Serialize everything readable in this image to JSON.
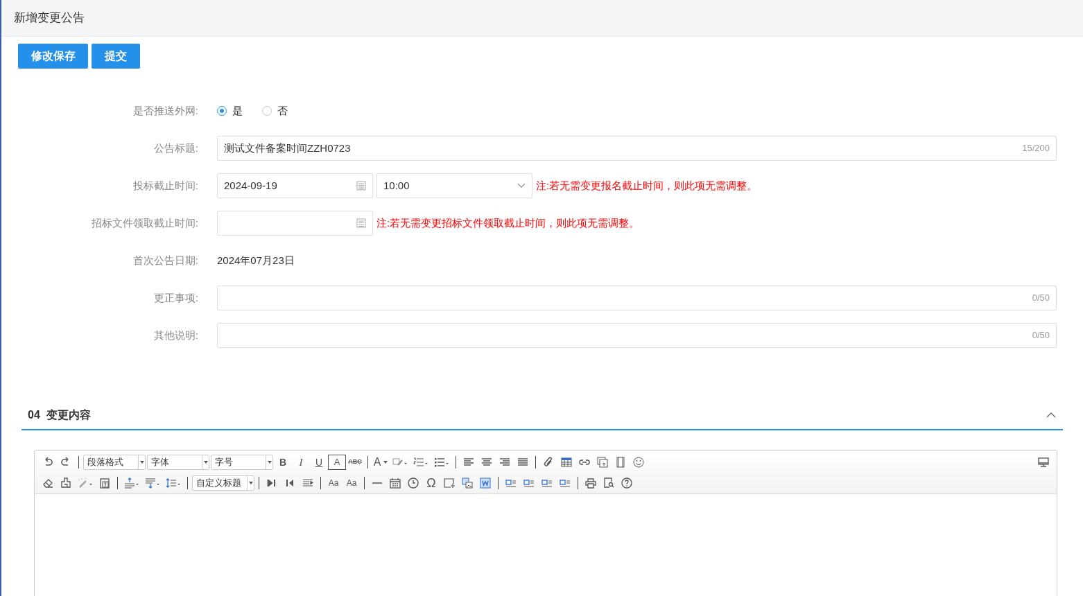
{
  "page_title": "新增变更公告",
  "actions": [
    {
      "label": "修改保存"
    },
    {
      "label": "提交"
    }
  ],
  "form": {
    "push": {
      "label": "是否推送外网:",
      "options": [
        {
          "label": "是",
          "selected": true
        },
        {
          "label": "否",
          "selected": false
        }
      ]
    },
    "title": {
      "label": "公告标题:",
      "value": "测试文件备案时间ZZH0723",
      "count": "15/200"
    },
    "bid_deadline": {
      "label": "投标截止时间:",
      "date": "2024-09-19",
      "time": "10:00",
      "note": "注:若无需变更报名截止时间，则此项无需调整。"
    },
    "doc_deadline": {
      "label": "招标文件领取截止时间:",
      "note": "注:若无需变更招标文件领取截止时间，则此项无需调整。"
    },
    "first_date": {
      "label": "首次公告日期:",
      "value": "2024年07月23日"
    },
    "corrections": {
      "label": "更正事项:",
      "count": "0/50"
    },
    "other": {
      "label": "其他说明:",
      "count": "0/50"
    }
  },
  "section": {
    "number": "04",
    "title": "变更内容",
    "expanded": true
  },
  "toolbar": [
    [
      {
        "kind": "undo"
      },
      {
        "kind": "redo"
      },
      {
        "kind": "sep"
      },
      {
        "kind": "select",
        "text": "段落格式"
      },
      {
        "kind": "select",
        "text": "字体"
      },
      {
        "kind": "select",
        "text": "字号"
      },
      {
        "kind": "bold",
        "text": "B"
      },
      {
        "kind": "italic",
        "text": "I"
      },
      {
        "kind": "underline",
        "text": "U"
      },
      {
        "kind": "boxed",
        "text": "A"
      },
      {
        "kind": "strike",
        "text": "ABC"
      },
      {
        "kind": "sep"
      },
      {
        "kind": "fontcolor",
        "text": "A"
      },
      {
        "kind": "highlight"
      },
      {
        "kind": "olist"
      },
      {
        "kind": "ulist"
      },
      {
        "kind": "sep"
      },
      {
        "kind": "alignleft"
      },
      {
        "kind": "aligncenter"
      },
      {
        "kind": "alignright"
      },
      {
        "kind": "justify"
      },
      {
        "kind": "sep"
      },
      {
        "kind": "attach"
      },
      {
        "kind": "table"
      },
      {
        "kind": "link"
      },
      {
        "kind": "image"
      },
      {
        "kind": "film"
      },
      {
        "kind": "smiley"
      },
      {
        "kind": "spacer"
      },
      {
        "kind": "monitor"
      }
    ],
    [
      {
        "kind": "eraser"
      },
      {
        "kind": "painter"
      },
      {
        "kind": "wand"
      },
      {
        "kind": "paste"
      },
      {
        "kind": "sep"
      },
      {
        "kind": "spacetop"
      },
      {
        "kind": "spacebottom"
      },
      {
        "kind": "lineheight"
      },
      {
        "kind": "sep"
      },
      {
        "kind": "select",
        "text": "自定义标题"
      },
      {
        "kind": "sep"
      },
      {
        "kind": "ltr"
      },
      {
        "kind": "rtl"
      },
      {
        "kind": "indent"
      },
      {
        "kind": "sep"
      },
      {
        "kind": "case",
        "text": "Aa"
      },
      {
        "kind": "case",
        "text": "Aa"
      },
      {
        "kind": "sep"
      },
      {
        "kind": "hr"
      },
      {
        "kind": "date"
      },
      {
        "kind": "clock"
      },
      {
        "kind": "omega",
        "text": "Ω"
      },
      {
        "kind": "anchor"
      },
      {
        "kind": "wordimage"
      },
      {
        "kind": "word"
      },
      {
        "kind": "sep"
      },
      {
        "kind": "layout"
      },
      {
        "kind": "layout"
      },
      {
        "kind": "layout"
      },
      {
        "kind": "layout"
      },
      {
        "kind": "sep"
      },
      {
        "kind": "print"
      },
      {
        "kind": "preview"
      },
      {
        "kind": "help"
      }
    ]
  ]
}
